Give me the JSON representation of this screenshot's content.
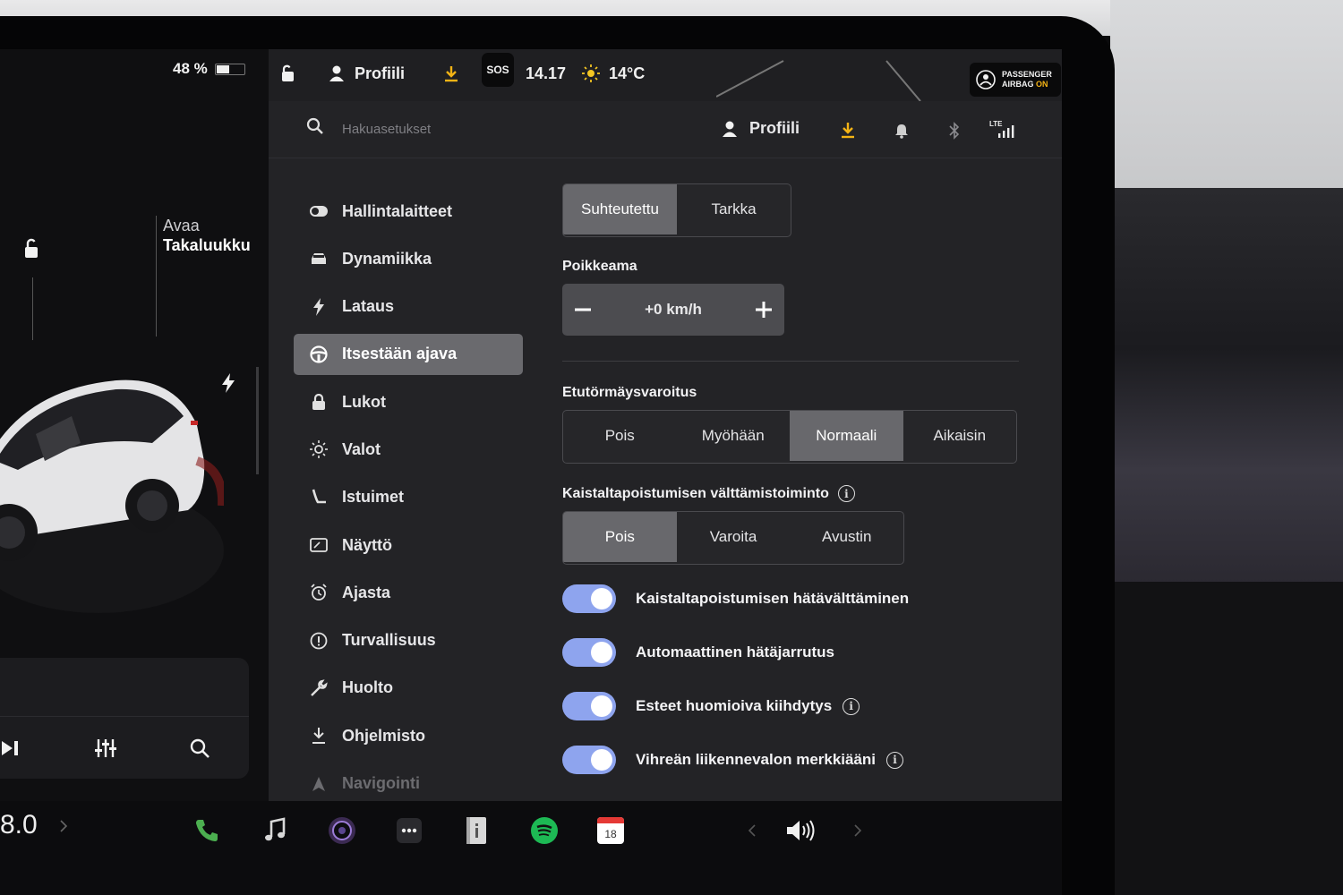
{
  "vehicle": {
    "battery_percent": "48 %",
    "battery_level": 0.48,
    "trunk_action": "Avaa",
    "trunk_name": "Takaluukku",
    "odometer_partial": "8.0"
  },
  "statusbar": {
    "profile_label": "Profiili",
    "sos_label": "SOS",
    "time": "14.17",
    "temperature": "14°C",
    "airbag_line1": "PASSENGER",
    "airbag_line2": "AIRBAG",
    "airbag_state": "ON"
  },
  "settings_header": {
    "search_placeholder": "Hakuasetukset",
    "profile_label": "Profiili",
    "signal_label": "LTE"
  },
  "nav": {
    "items": [
      {
        "label": "Hallintalaitteet",
        "icon": "toggle-icon"
      },
      {
        "label": "Dynamiikka",
        "icon": "car-icon"
      },
      {
        "label": "Lataus",
        "icon": "bolt-icon"
      },
      {
        "label": "Itsestään ajava",
        "icon": "steering-wheel-icon",
        "active": true
      },
      {
        "label": "Lukot",
        "icon": "lock-icon"
      },
      {
        "label": "Valot",
        "icon": "light-icon"
      },
      {
        "label": "Istuimet",
        "icon": "seat-icon"
      },
      {
        "label": "Näyttö",
        "icon": "display-icon"
      },
      {
        "label": "Ajasta",
        "icon": "alarm-clock-icon"
      },
      {
        "label": "Turvallisuus",
        "icon": "alert-circle-icon"
      },
      {
        "label": "Huolto",
        "icon": "wrench-icon"
      },
      {
        "label": "Ohjelmisto",
        "icon": "download-icon"
      },
      {
        "label": "Navigointi",
        "icon": "navigation-icon"
      }
    ]
  },
  "content": {
    "speed_mode": {
      "options": [
        "Suhteutettu",
        "Tarkka"
      ],
      "selected": "Suhteutettu"
    },
    "offset": {
      "label": "Poikkeama",
      "value": "+0 km/h"
    },
    "collision_warning": {
      "label": "Etutörmäysvaroitus",
      "options": [
        "Pois",
        "Myöhään",
        "Normaali",
        "Aikaisin"
      ],
      "selected": "Normaali"
    },
    "lane_departure": {
      "label": "Kaistaltapoistumisen välttämistoiminto",
      "options": [
        "Pois",
        "Varoita",
        "Avustin"
      ],
      "selected": "Pois"
    },
    "toggles": [
      {
        "label": "Kaistaltapoistumisen hätävälttäminen",
        "on": true,
        "info": false
      },
      {
        "label": "Automaattinen hätäjarrutus",
        "on": true,
        "info": false
      },
      {
        "label": "Esteet huomioiva kiihdytys",
        "on": true,
        "info": true
      },
      {
        "label": "Vihreän liikennevalon merkkiääni",
        "on": true,
        "info": true
      }
    ]
  },
  "dock": {
    "calendar_day": "18"
  },
  "colors": {
    "accent_download": "#f3b315",
    "toggle_on": "#8ea4ee",
    "phone_green": "#4caf50",
    "spotify_green": "#1db954"
  }
}
